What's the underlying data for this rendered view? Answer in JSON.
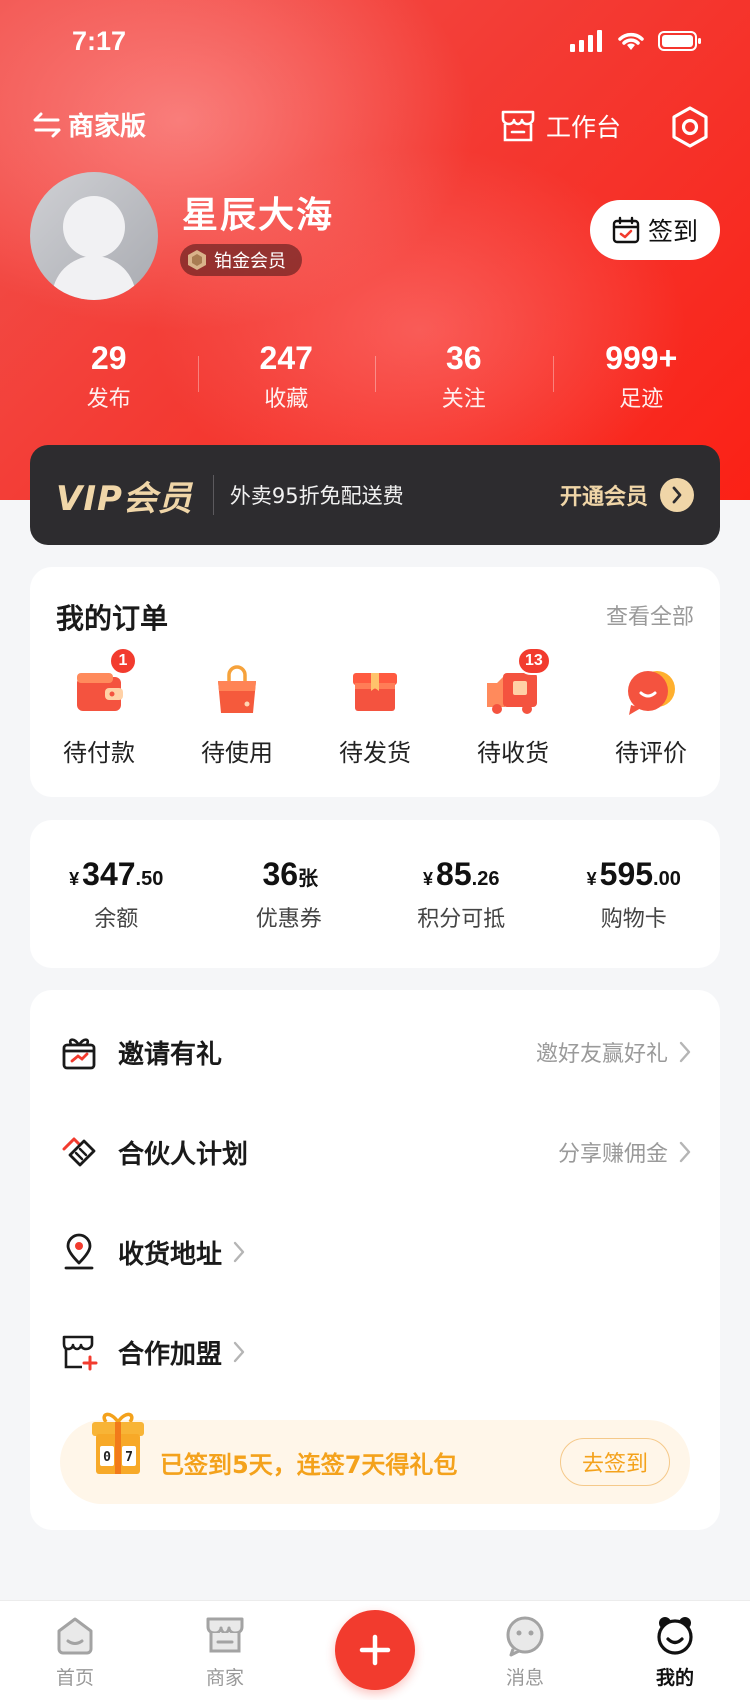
{
  "status_bar": {
    "time": "7:17"
  },
  "header": {
    "mode_switch_label": "商家版",
    "workbench_label": "工作台",
    "username": "星辰大海",
    "member_level": "铂金会员",
    "checkin_label": "签到"
  },
  "stats": [
    {
      "value": "29",
      "label": "发布"
    },
    {
      "value": "247",
      "label": "收藏"
    },
    {
      "value": "36",
      "label": "关注"
    },
    {
      "value": "999+",
      "label": "足迹"
    }
  ],
  "vip": {
    "title": "VIP会员",
    "description": "外卖95折免配送费",
    "action_label": "开通会员"
  },
  "orders": {
    "title": "我的订单",
    "view_all_label": "查看全部",
    "items": [
      {
        "label": "待付款",
        "icon": "wallet-icon",
        "badge": "1"
      },
      {
        "label": "待使用",
        "icon": "shopping-bag-icon",
        "badge": ""
      },
      {
        "label": "待发货",
        "icon": "package-box-icon",
        "badge": ""
      },
      {
        "label": "待收货",
        "icon": "delivery-truck-icon",
        "badge": "13"
      },
      {
        "label": "待评价",
        "icon": "comment-bubble-icon",
        "badge": ""
      }
    ]
  },
  "wallet": [
    {
      "prefix": "¥",
      "integer": "347",
      "suffix": ".50",
      "label": "余额"
    },
    {
      "prefix": "",
      "integer": "36",
      "suffix": "张",
      "label": "优惠券"
    },
    {
      "prefix": "¥",
      "integer": "85",
      "suffix": ".26",
      "label": "积分可抵"
    },
    {
      "prefix": "¥",
      "integer": "595",
      "suffix": ".00",
      "label": "购物卡"
    }
  ],
  "menu": [
    {
      "label": "邀请有礼",
      "hint": "邀好友赢好礼",
      "icon": "gift-icon"
    },
    {
      "label": "合伙人计划",
      "hint": "分享赚佣金",
      "icon": "handshake-icon"
    },
    {
      "label": "收货地址",
      "hint": "",
      "icon": "location-pin-icon"
    },
    {
      "label": "合作加盟",
      "hint": "",
      "icon": "store-add-icon"
    }
  ],
  "promo": {
    "text": "已签到5天，连签7天得礼包",
    "button_label": "去签到",
    "counter": "07"
  },
  "tabbar": [
    {
      "label": "首页",
      "icon": "home-icon",
      "active": false
    },
    {
      "label": "商家",
      "icon": "shop-icon",
      "active": false
    },
    {
      "label": "消息",
      "icon": "message-icon",
      "active": false
    },
    {
      "label": "我的",
      "icon": "profile-icon",
      "active": true
    }
  ],
  "colors": {
    "primary_red": "#f23b2e",
    "vip_gold": "#f0d6a8",
    "promo_orange": "#f4a21c"
  }
}
